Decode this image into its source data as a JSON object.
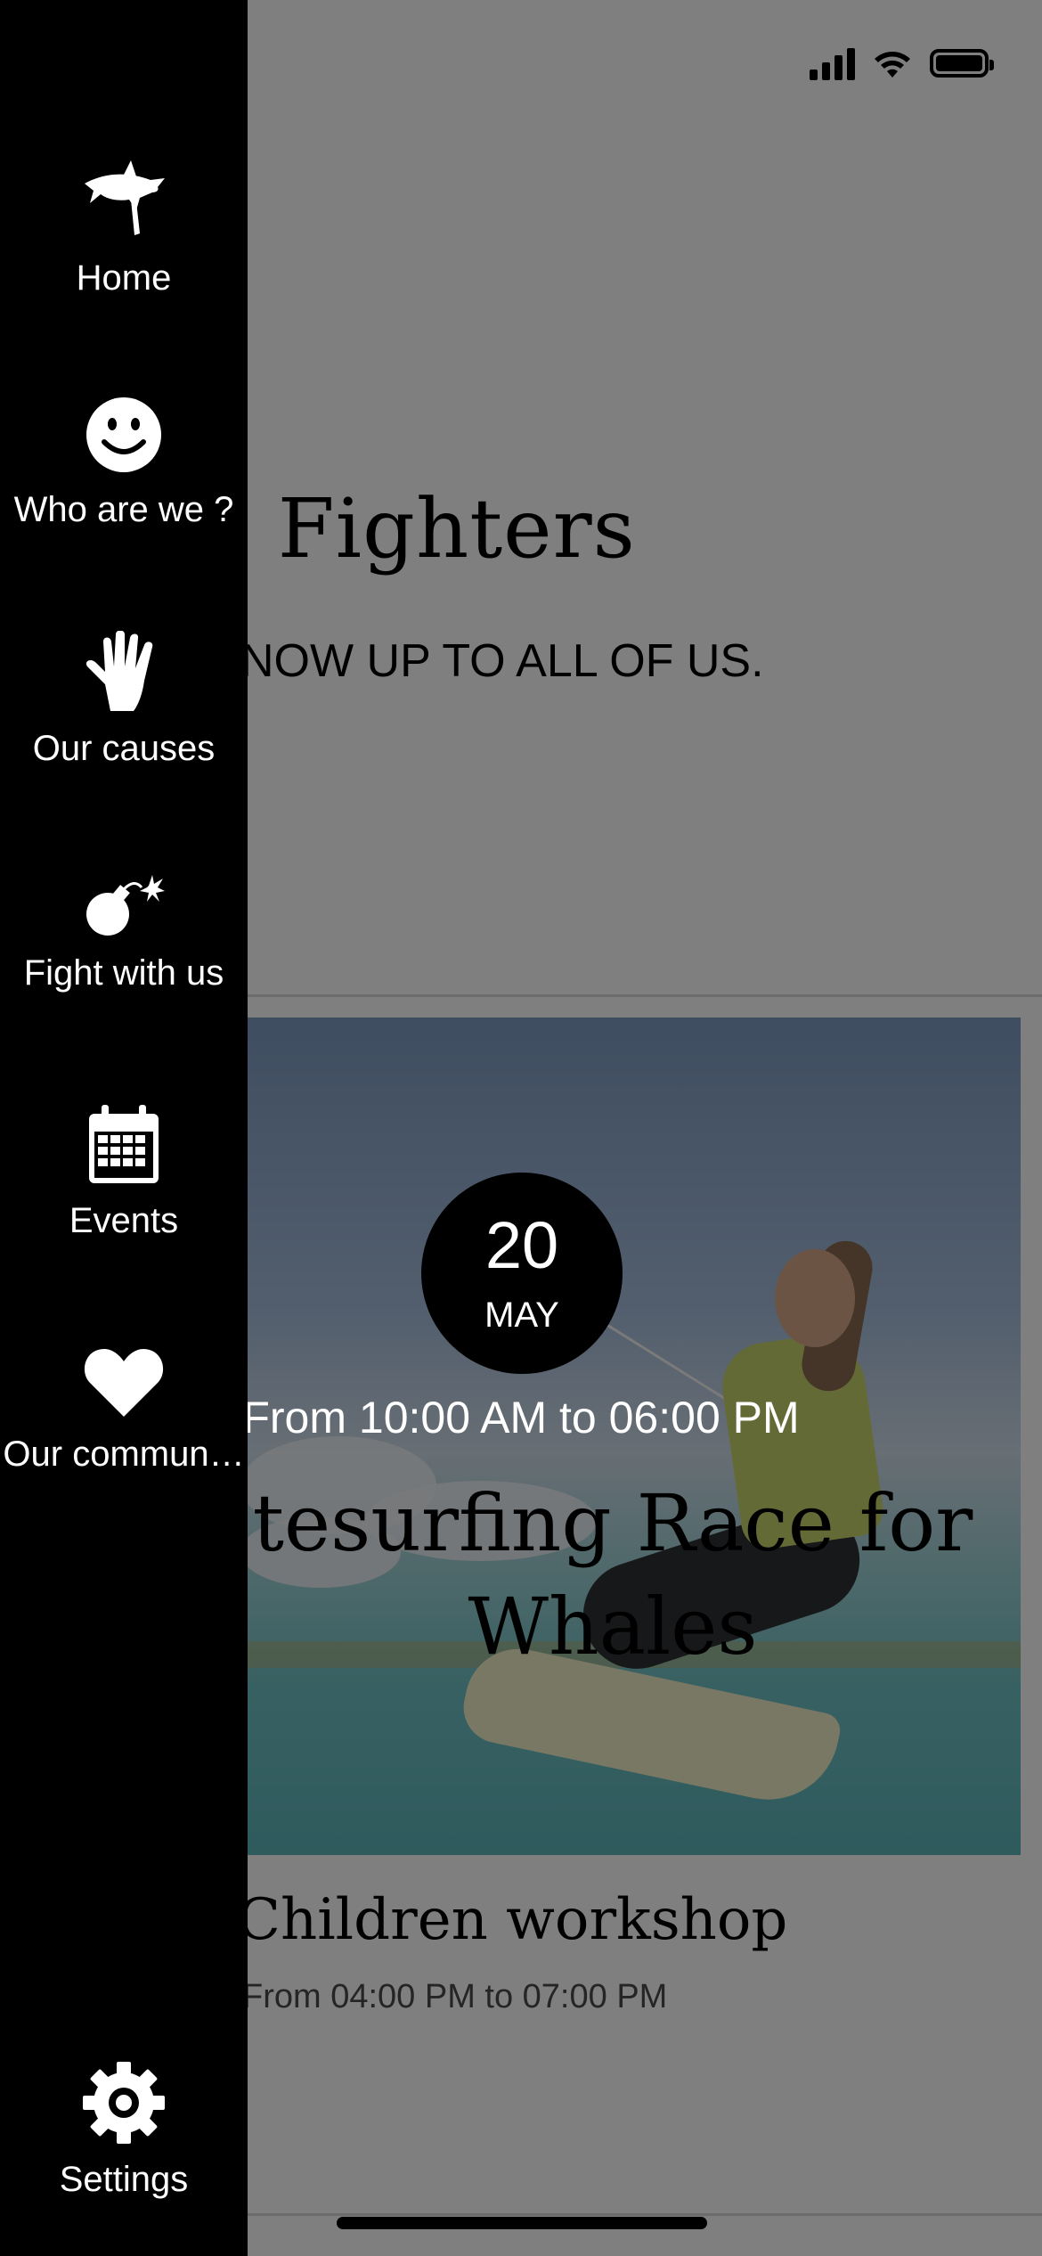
{
  "drawer": {
    "items": [
      {
        "label": "Home",
        "icon": "shark-icon"
      },
      {
        "label": "Who are we ?",
        "icon": "smiley-icon"
      },
      {
        "label": "Our causes",
        "icon": "hand-icon"
      },
      {
        "label": "Fight with us",
        "icon": "bomb-icon"
      },
      {
        "label": "Events",
        "icon": "calendar-icon"
      },
      {
        "label": "Our commun…",
        "icon": "heart-icon"
      }
    ],
    "settings": {
      "label": "Settings",
      "icon": "gear-icon"
    }
  },
  "hero": {
    "title": "ean Fighters",
    "subtitle": "NOW UP TO ALL OF US."
  },
  "events": [
    {
      "day": "20",
      "month": "MAY",
      "time": "From 10:00 AM to 06:00 PM",
      "title": "tesurfing Race for Whales"
    },
    {
      "title": "Children workshop",
      "time": "From 04:00 PM to 07:00 PM"
    }
  ],
  "colors": {
    "drawer_bg": "#000000",
    "overlay": "rgba(0,0,0,0.5)",
    "text_light": "#ffffff"
  }
}
